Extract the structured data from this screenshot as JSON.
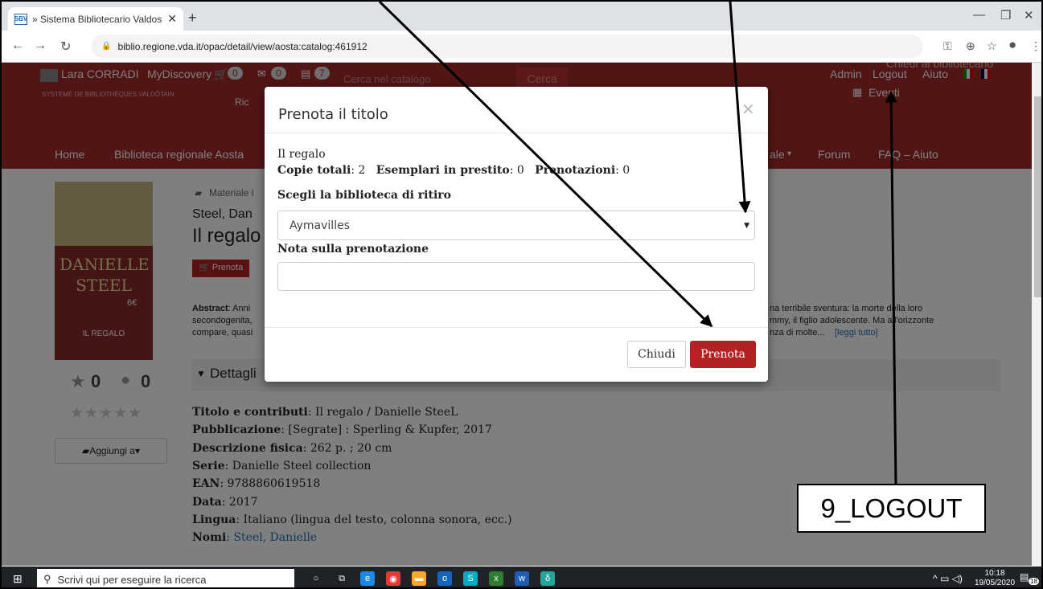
{
  "browser": {
    "tab_title": "» Sistema Bibliotecario Valdostan",
    "tab_favicon": "SBV",
    "url": "biblio.regione.vda.it/opac/detail/view/aosta:catalog:461912"
  },
  "site_header": {
    "user": "Lara CORRADI",
    "mydiscovery": "MyDiscovery",
    "cart_count": "0",
    "msg_count": "0",
    "book_count": "7",
    "logo_sub": "SYSTÈME DE BIBLIOTHÈQUES VALDÔTAIN",
    "search_placeholder": "Cerca nel catalogo",
    "search_button": "Cerca",
    "ric": "Ric",
    "admin": "Admin",
    "logout": "Logout",
    "aiuto": "Aiuto",
    "eventi": "Eventi",
    "chiedi": "Chiedi al bibliotecario"
  },
  "nav": {
    "home": "Home",
    "biblioteca": "Biblioteca regionale Aosta",
    "ale": "ale",
    "forum": "Forum",
    "faq": "FAQ – Aiuto"
  },
  "book": {
    "cover_author": "DANIELLE STEEL",
    "cover_title": "IL REGALO",
    "cover_price": "6€",
    "materiale": "Materiale l",
    "author_short": "Steel, Dan",
    "title_short": "Il regalo",
    "prenota_small": "Prenota",
    "stars": "0",
    "comments": "0",
    "aggiungi": "Aggiungi a",
    "abstract_label": "Abstract",
    "abstract_1a": ": Anni",
    "abstract_2a": "secondogenita,",
    "abstract_3a": "compare, quasi",
    "abstract_1b": "na terribile sventura: la morte della loro",
    "abstract_2b": "mmy, il figlio adolescente. Ma all'orizzonte",
    "abstract_3b": "nza di molte...",
    "leggi": "[leggi tutto]",
    "dettagli": "Dettagli",
    "details": [
      {
        "label": "Titolo e contributi",
        "value": ":  Il regalo / Danielle SteeL"
      },
      {
        "label": "Pubblicazione",
        "value": ":  [Segrate] : Sperling & Kupfer, 2017"
      },
      {
        "label": "Descrizione fisica",
        "value": ":  262 p. ; 20 cm"
      },
      {
        "label": "Serie",
        "value": ":  Danielle Steel collection"
      },
      {
        "label": "EAN",
        "value": ":  9788860619518"
      },
      {
        "label": "Data",
        "value": ":  2017"
      },
      {
        "label": "Lingua",
        "value": ":  Italiano (lingua del testo, colonna sonora, ecc.)"
      },
      {
        "label": "Nomi",
        "value": ":  Steel, Danielle"
      }
    ]
  },
  "modal": {
    "title": "Prenota il titolo",
    "item_title": "Il regalo",
    "copie_label": "Copie totali",
    "copie_value": ": 2",
    "prestito_label": "Esemplari in prestito",
    "prestito_value": ": 0",
    "prenotazioni_label": "Prenotazioni",
    "prenotazioni_value": ": 0",
    "pickup_label": "Scegli la biblioteca di ritiro",
    "pickup_value": "Aymavilles",
    "note_label": "Nota sulla prenotazione",
    "close_button": "Chiudi",
    "submit_button": "Prenota"
  },
  "annotation": {
    "label": "9_LOGOUT"
  },
  "taskbar": {
    "search_placeholder": "Scrivi qui per eseguire la ricerca",
    "time": "10:18",
    "date": "19/05/2020",
    "notifications": "18"
  }
}
